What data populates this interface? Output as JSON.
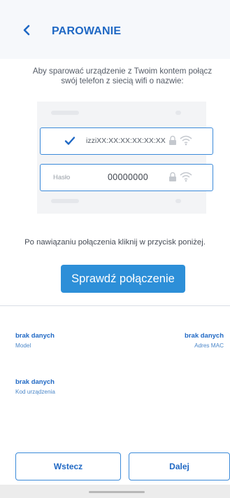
{
  "header": {
    "title": "PAROWANIE"
  },
  "instructions": {
    "intro": "Aby sparować urządzenie z Twoim kontem połącz swój telefon z siecią wifi o nazwie:",
    "ssid": "izziXX:XX:XX:XX:XX:XX",
    "password_label": "Hasło",
    "password_value": "00000000",
    "hint": "Po nawiązaniu połączenia kliknij w przycisk poniżej.",
    "check_button": "Sprawdź połączenie"
  },
  "device_info": {
    "model": {
      "value": "brak danych",
      "label": "Model"
    },
    "mac": {
      "value": "brak danych",
      "label": "Adres MAC"
    },
    "device_code": {
      "value": "brak danych",
      "label": "Kod urządzenia"
    }
  },
  "footer": {
    "back_label": "Wstecz",
    "next_label": "Dalej"
  },
  "icons": {
    "back": "chevron-left-icon",
    "selected": "check-icon",
    "lock": "lock-icon",
    "wifi": "wifi-icon"
  },
  "colors": {
    "accent": "#2d8fd8",
    "text_accent": "#1f68c4",
    "border": "#3b8ad9"
  }
}
